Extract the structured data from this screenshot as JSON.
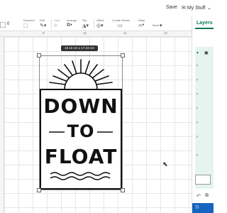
{
  "topbar": {
    "save_label": "Save",
    "mystuff_label": "My Stuff"
  },
  "toolbar": {
    "groups": [
      {
        "label": "Deselect"
      },
      {
        "label": "Edit"
      },
      {
        "label": "Align"
      },
      {
        "label": "Arrange"
      },
      {
        "label": "Flip"
      },
      {
        "label": "Offset"
      },
      {
        "label": "Create Sticker"
      },
      {
        "label": "Warp"
      },
      {
        "label": "More"
      }
    ],
    "field_value": "0"
  },
  "ruler": {
    "marks": [
      "9",
      "10",
      "11",
      "12"
    ]
  },
  "canvas": {
    "dimension_label": "10.15 cm x 17.23 cm"
  },
  "design": {
    "line1": "DOWN",
    "line2": "TO",
    "line3": "FLOAT"
  },
  "panel": {
    "tab_label": "Layers",
    "try_label": "Tr"
  },
  "colors": {
    "accent": "#0a7a5c",
    "layer_bg": "#e6f4ee",
    "button": "#1565c0"
  }
}
